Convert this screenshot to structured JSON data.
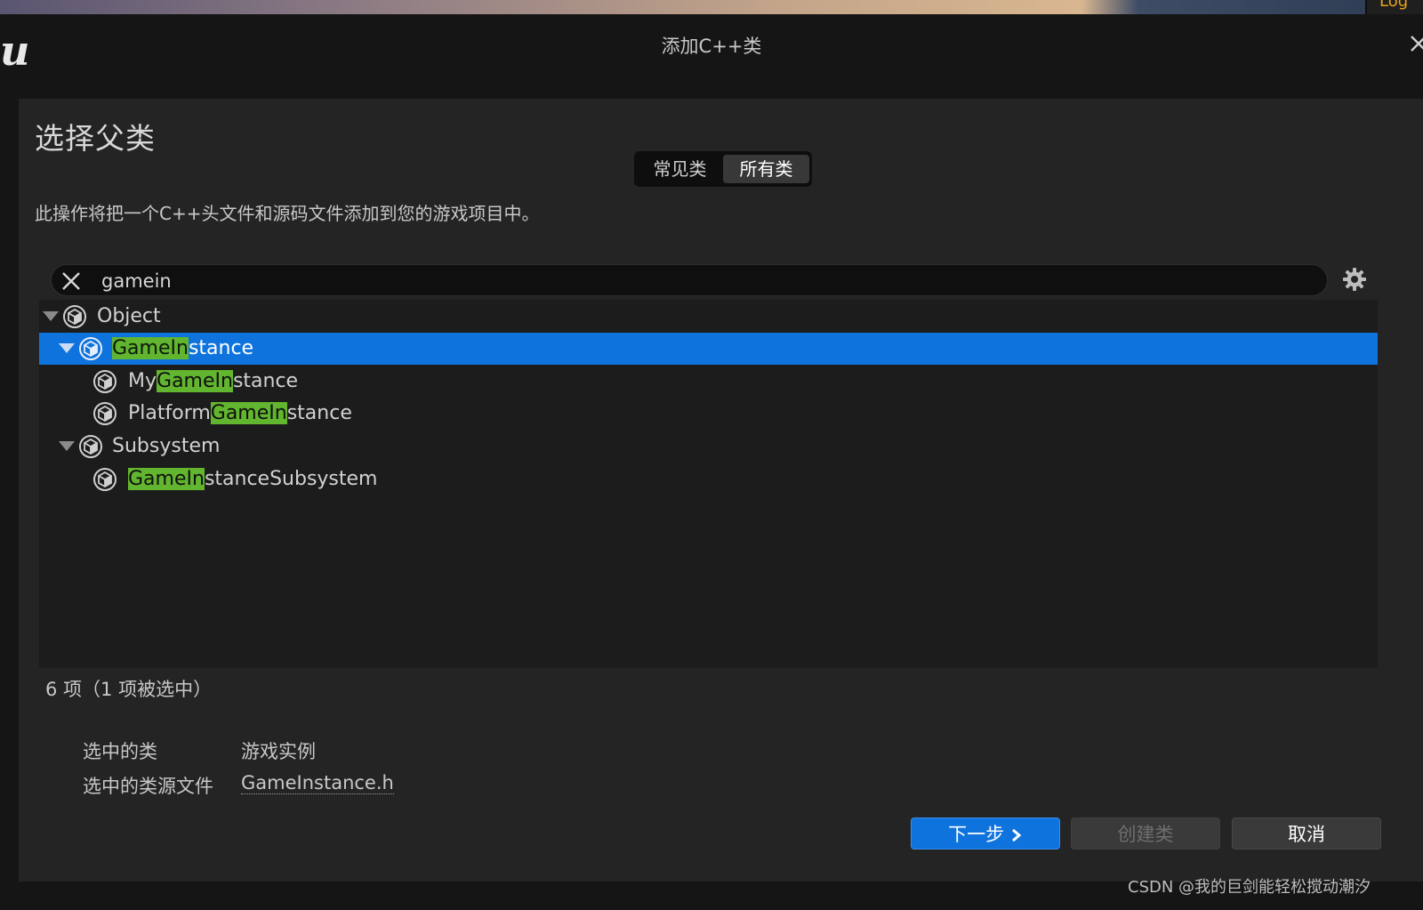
{
  "window": {
    "title": "添加C++类",
    "logo_text": "u",
    "top_strip_text": "Log"
  },
  "dialog": {
    "heading": "选择父类",
    "tabs": [
      {
        "label": "常见类",
        "active": false
      },
      {
        "label": "所有类",
        "active": true
      }
    ],
    "description": "此操作将把一个C++头文件和源码文件添加到您的游戏项目中。"
  },
  "search": {
    "value": "gamein",
    "placeholder": ""
  },
  "tree": {
    "items": [
      {
        "pre": "",
        "match": "",
        "post": "Object",
        "depth": 0,
        "expandable": true,
        "selected": false
      },
      {
        "pre": "",
        "match": "GameIn",
        "post": "stance",
        "depth": 1,
        "expandable": true,
        "selected": true
      },
      {
        "pre": "My",
        "match": "GameIn",
        "post": "stance",
        "depth": 2,
        "expandable": false,
        "selected": false
      },
      {
        "pre": "Platform",
        "match": "GameIn",
        "post": "stance",
        "depth": 2,
        "expandable": false,
        "selected": false
      },
      {
        "pre": "",
        "match": "",
        "post": "Subsystem",
        "depth": 1,
        "expandable": true,
        "selected": false
      },
      {
        "pre": "",
        "match": "GameIn",
        "post": "stanceSubsystem",
        "depth": 2,
        "expandable": false,
        "selected": false
      }
    ]
  },
  "status": {
    "count_text": "6 项（1 项被选中）"
  },
  "selection_info": {
    "class_label": "选中的类",
    "class_value": "游戏实例",
    "source_label": "选中的类源文件",
    "source_value": "GameInstance.h"
  },
  "buttons": {
    "next": "下一步",
    "create": "创建类",
    "cancel": "取消"
  },
  "watermark": "CSDN @我的巨剑能轻松搅动潮汐",
  "colors": {
    "accent": "#0f73de",
    "highlight": "#62b52e",
    "panel": "#242424",
    "tree_bg": "#1c1c1c",
    "title_bar": "#151515"
  }
}
